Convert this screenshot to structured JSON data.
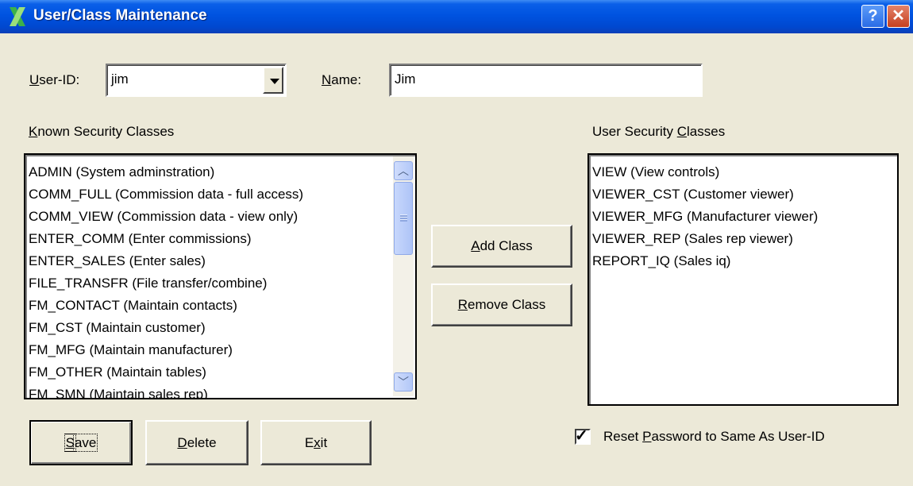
{
  "window": {
    "title": "User/Class Maintenance",
    "app_icon": "x-logo-icon"
  },
  "titlebar_buttons": {
    "help": "?",
    "close": "✕"
  },
  "user_id": {
    "label_accel": "U",
    "label_rest": "ser-ID:",
    "value": "jim"
  },
  "name": {
    "label_accel": "N",
    "label_rest": "ame:",
    "value": "Jim"
  },
  "known_classes": {
    "label_accel": "K",
    "label_rest": "nown Security Classes",
    "items": [
      "ADMIN (System adminstration)",
      "COMM_FULL (Commission data - full access)",
      "COMM_VIEW (Commission data - view only)",
      "ENTER_COMM (Enter commissions)",
      "ENTER_SALES (Enter sales)",
      "FILE_TRANSFR (File transfer/combine)",
      "FM_CONTACT (Maintain contacts)",
      "FM_CST (Maintain customer)",
      "FM_MFG (Maintain manufacturer)",
      "FM_OTHER (Maintain tables)",
      "FM_SMN (Maintain sales rep)"
    ]
  },
  "user_classes": {
    "label_pre": "User Security ",
    "label_accel": "C",
    "label_rest": "lasses",
    "items": [
      "VIEW (View controls)",
      "VIEWER_CST (Customer viewer)",
      "VIEWER_MFG (Manufacturer viewer)",
      "VIEWER_REP (Sales rep viewer)",
      "REPORT_IQ (Sales iq)"
    ]
  },
  "buttons": {
    "add": {
      "accel": "A",
      "rest": "dd Class"
    },
    "remove": {
      "accel": "R",
      "rest": "emove Class"
    },
    "save": {
      "accel": "S",
      "rest": "ave"
    },
    "delete": {
      "accel": "D",
      "rest": "elete"
    },
    "exit": {
      "pre": "E",
      "accel": "x",
      "rest": "it"
    }
  },
  "reset_password": {
    "checked": true,
    "label_pre": "Reset ",
    "label_accel": "P",
    "label_rest": "assword to Same As User-ID"
  }
}
